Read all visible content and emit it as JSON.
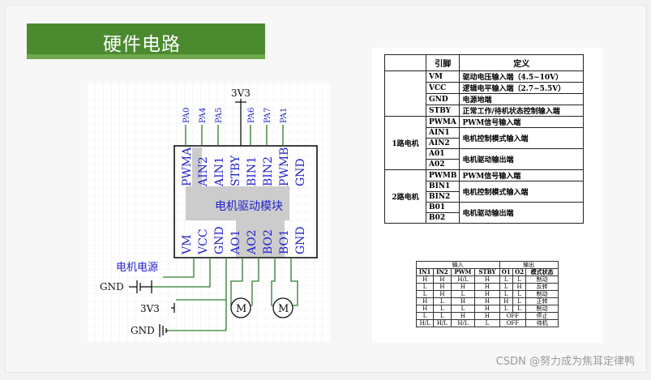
{
  "title": "硬件电路",
  "watermark": "CSDN @努力成为焦耳定律鸭",
  "colors": {
    "title_bg": "#4b8a2f",
    "label_blue": "#2222cc",
    "wire_green": "#2e7d32",
    "highlight": "#cccccc"
  },
  "circuit": {
    "module_label": "电机驱动模块",
    "power_label": "电机电源",
    "vcc_label": "3V3",
    "top_pin_labels": [
      "PA0",
      "PA4",
      "PA5",
      "PA6",
      "PA7",
      "PA1"
    ],
    "top_pins": [
      "PWMA",
      "AIN2",
      "AIN1",
      "STBY",
      "BIN1",
      "BIN2",
      "PWMB",
      "GND"
    ],
    "bottom_pins": [
      "VM",
      "VCC",
      "GND",
      "AO1",
      "AO2",
      "BO2",
      "BO1",
      "GND"
    ],
    "gnd_label": "GND",
    "motor_label": "M"
  },
  "pin_table": {
    "headers": [
      "",
      "引脚",
      "定义"
    ],
    "rows": [
      [
        "",
        "VM",
        "驱动电压输入端（4.5~10V）"
      ],
      [
        "",
        "VCC",
        "逻辑电平输入端（2.7~5.5V）"
      ],
      [
        "",
        "GND",
        "电源地端"
      ],
      [
        "",
        "STBY",
        "正常工作/待机状态控制输入端"
      ],
      [
        "1路电机",
        "PWMA",
        "PWM信号输入端"
      ],
      [
        "",
        "AIN1",
        "电机控制模式输入端"
      ],
      [
        "",
        "AIN2",
        ""
      ],
      [
        "",
        "A01",
        "电机驱动输出端"
      ],
      [
        "",
        "A02",
        ""
      ],
      [
        "2路电机",
        "PWMB",
        "PWM信号输入端"
      ],
      [
        "",
        "BIN1",
        "电机控制模式输入端"
      ],
      [
        "",
        "BIN2",
        ""
      ],
      [
        "",
        "B01",
        "电机驱动输出端"
      ],
      [
        "",
        "B02",
        ""
      ]
    ]
  },
  "truth_table": {
    "group_headers": [
      "输入",
      "输出"
    ],
    "headers": [
      "IN1",
      "IN2",
      "PWM",
      "STBY",
      "O1",
      "O2",
      "模式状态"
    ],
    "rows": [
      [
        "H",
        "H",
        "H/L",
        "H",
        "L",
        "L",
        "制动"
      ],
      [
        "L",
        "H",
        "H",
        "H",
        "L",
        "H",
        "反转"
      ],
      [
        "L",
        "H",
        "L",
        "H",
        "L",
        "L",
        "制动"
      ],
      [
        "H",
        "L",
        "H",
        "H",
        "H",
        "L",
        "正转"
      ],
      [
        "H",
        "L",
        "L",
        "H",
        "L",
        "L",
        "制动"
      ],
      [
        "L",
        "L",
        "H",
        "H",
        "OFF",
        "",
        "停止"
      ],
      [
        "H/L",
        "H/L",
        "H/L",
        "L",
        "OFF",
        "",
        "待机"
      ]
    ]
  }
}
